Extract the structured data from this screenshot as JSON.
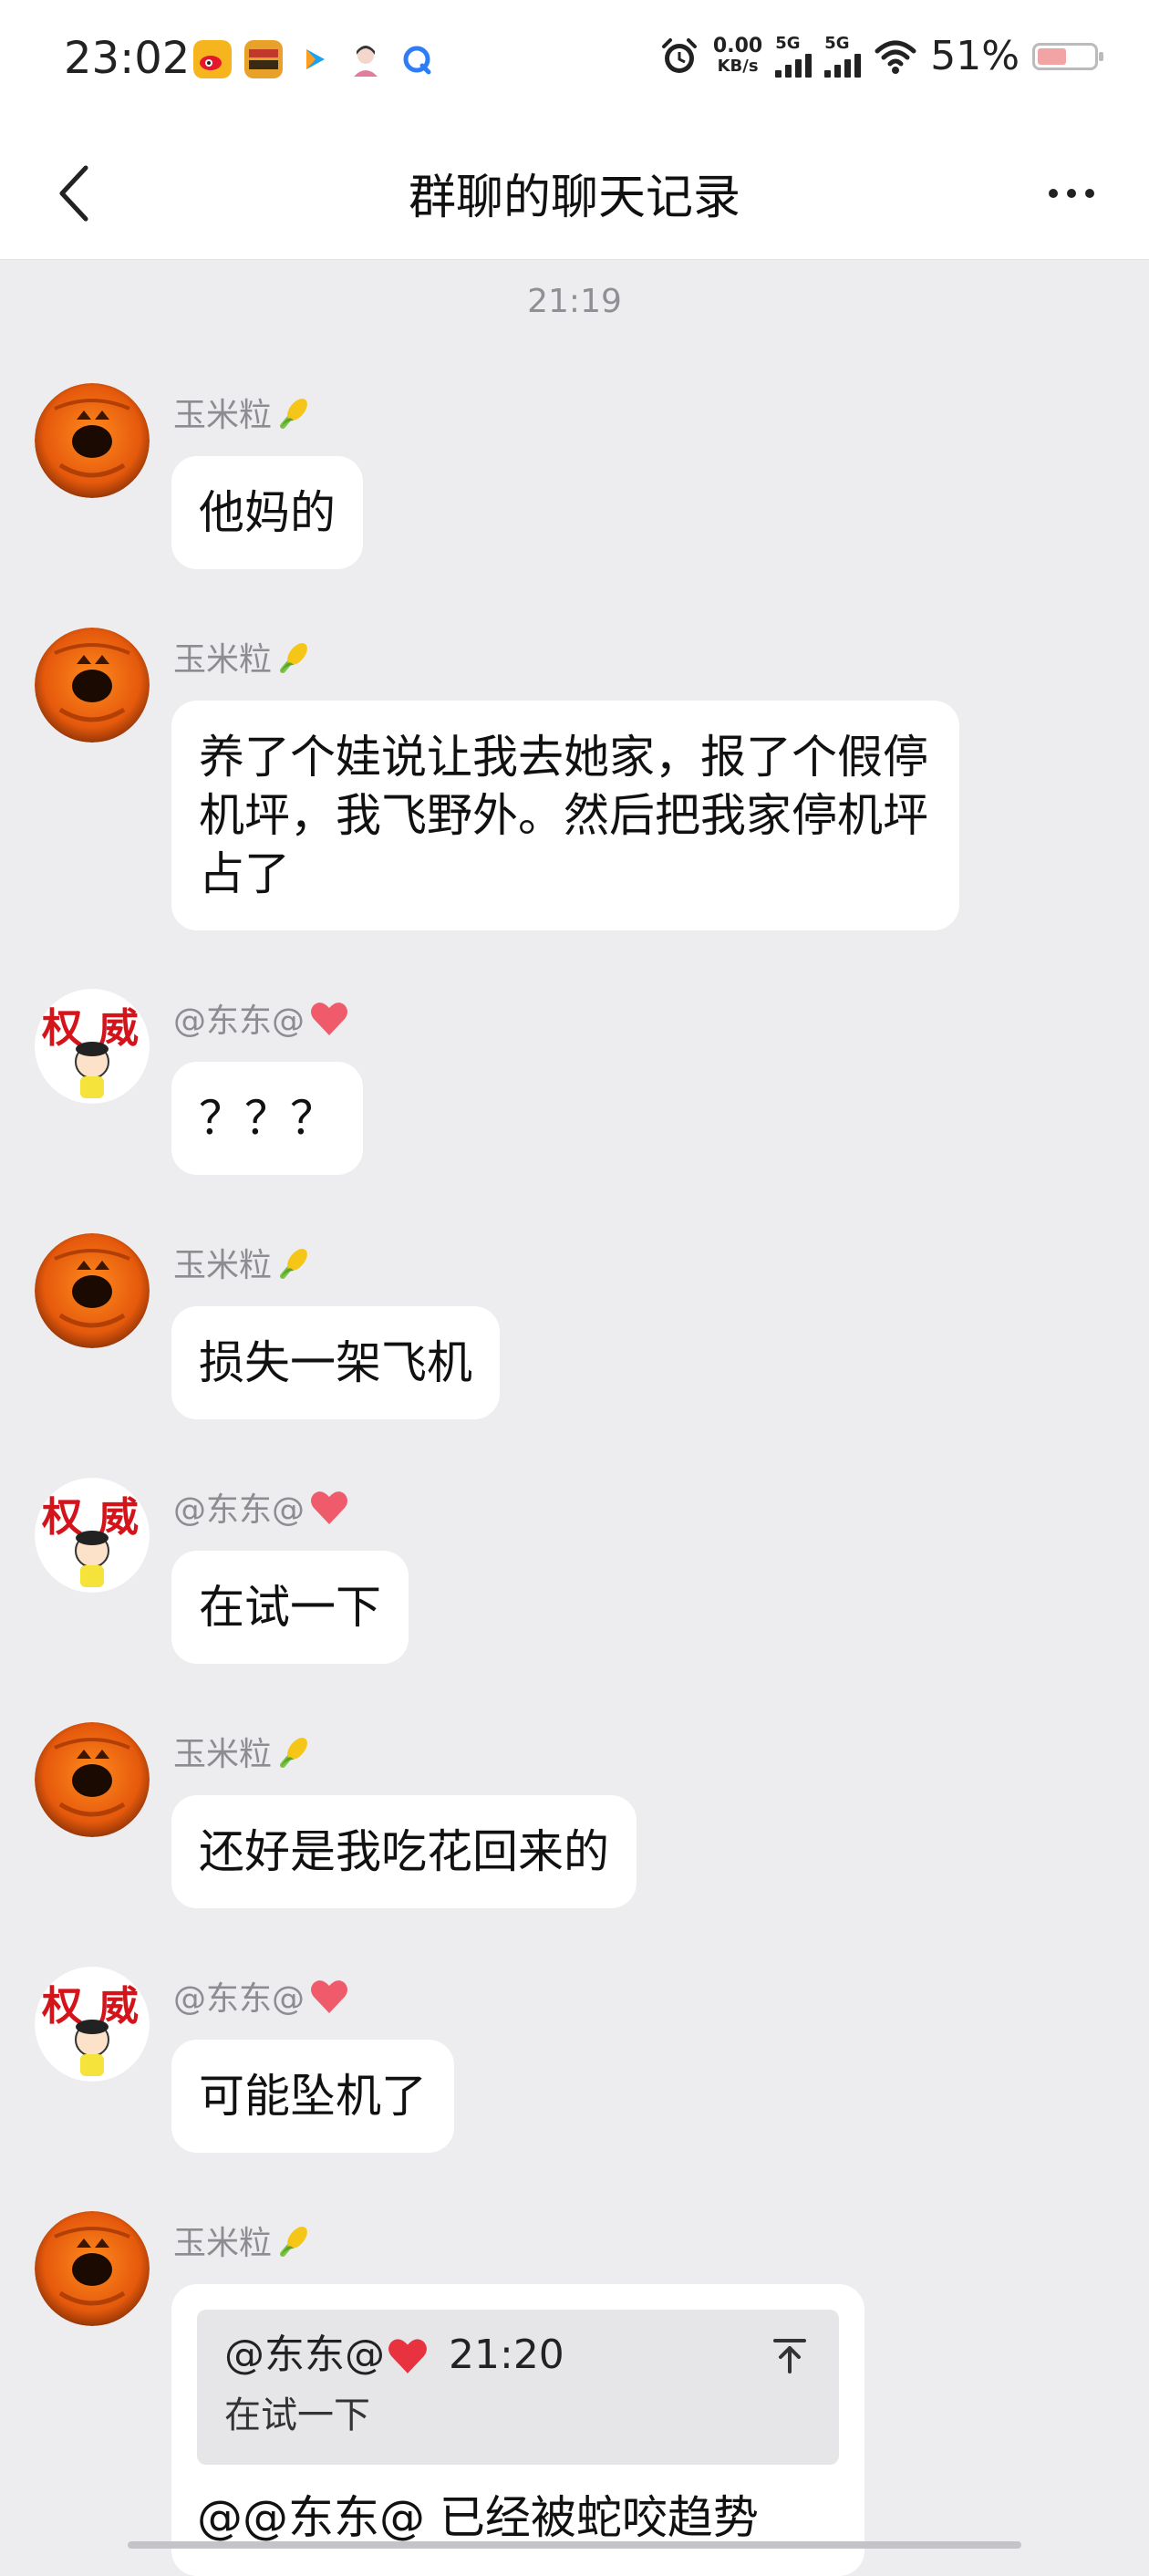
{
  "status_bar": {
    "time": "23:02",
    "net_speed": "0.00",
    "net_unit": "KB/s",
    "sim1": "5G",
    "sim2": "5G",
    "battery_pct": "51%",
    "battery_level": 0.51,
    "apps": [
      "weibo-icon",
      "zhihu-news-icon",
      "video-icon",
      "avatar-app-icon",
      "browser-icon"
    ]
  },
  "nav": {
    "title": "群聊的聊天记录"
  },
  "timestamp": "21:19",
  "senders": {
    "a": "玉米粒",
    "b": "@东东@"
  },
  "messages": [
    {
      "sender": "玉米粒",
      "text": "他妈的"
    },
    {
      "sender": "玉米粒",
      "text": "养了个娃说让我去她家，报了个假停机坪，我飞野外。然后把我家停机坪占了"
    },
    {
      "sender": "@东东@",
      "text": "？？？"
    },
    {
      "sender": "玉米粒",
      "text": "损失一架飞机"
    },
    {
      "sender": "@东东@",
      "text": "在试一下"
    },
    {
      "sender": "玉米粒",
      "text": "还好是我吃花回来的"
    },
    {
      "sender": "@东东@",
      "text": "可能坠机了"
    },
    {
      "sender": "玉米粒",
      "quote": {
        "author": "@东东@",
        "time": "21:20",
        "text": "在试一下"
      },
      "text": "@@东东@ 已经被蛇咬趋势"
    }
  ],
  "colors": {
    "page_bg": "#ededf0",
    "bubble_bg": "#ffffff",
    "quote_bg": "#e6e6e9",
    "heart": "#e84a5a"
  }
}
